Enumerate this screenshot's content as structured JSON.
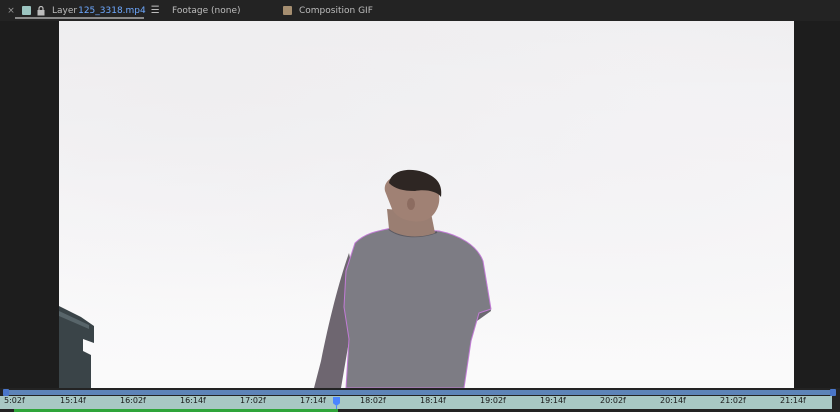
{
  "tabs": {
    "layer": {
      "prefix": "Layer",
      "name": "125_3318.mp4",
      "swatch_color": "#9cc5c1"
    },
    "footage": {
      "label": "Footage (none)"
    },
    "composition": {
      "label": "Composition GIF",
      "swatch_color": "#a58e70"
    }
  },
  "icons": {
    "close": "close-icon",
    "lock": "lock-icon",
    "menu": "hamburger-menu-icon"
  },
  "timeline": {
    "ticks": [
      "5:02f",
      "15:14f",
      "16:02f",
      "16:14f",
      "17:02f",
      "17:14f",
      "18:02f",
      "18:14f",
      "19:02f",
      "19:14f",
      "20:02f",
      "20:14f",
      "21:02f",
      "21:14f"
    ],
    "ruler_color": "#a8c8c4",
    "work_area_color": "#5d84b8",
    "playhead_color": "#4b84ff",
    "cache_color": "#2fa43a"
  }
}
